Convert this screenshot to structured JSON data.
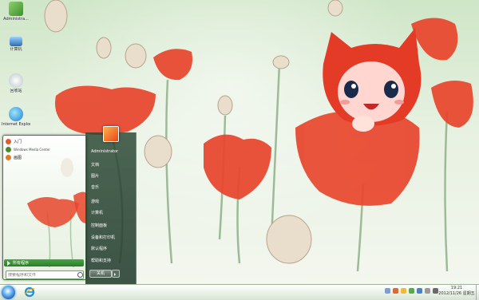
{
  "desktop": {
    "icons": [
      {
        "label": "Administra...",
        "icon": "user-folder-icon"
      },
      {
        "label": "计算机",
        "icon": "computer-icon"
      },
      {
        "label": "回收站",
        "icon": "recycle-bin-icon"
      },
      {
        "label": "Internet Explorer",
        "icon": "internet-explorer-icon"
      }
    ]
  },
  "start_menu": {
    "pinned": [
      {
        "label": "入门",
        "sub": "",
        "color": "#e55a2b"
      },
      {
        "label": "Windows Media Center",
        "sub": "",
        "color": "#4a8a2a"
      },
      {
        "label": "画图",
        "sub": "",
        "color": "#e07a2a"
      }
    ],
    "all_programs": "所有程序",
    "search_placeholder": "搜索程序和文件",
    "user_name": "Administrator",
    "right_items": [
      "文档",
      "图片",
      "音乐",
      "游戏",
      "计算机",
      "控制面板",
      "设备和打印机",
      "默认程序",
      "帮助和支持"
    ],
    "shutdown": "关机"
  },
  "taskbar": {
    "start_icon": "windows-start-orb-icon",
    "pinned_icon": "internet-explorer-icon",
    "clock_time": "19:21",
    "clock_date": "2012/11/26 星期五"
  },
  "colors": {
    "accent_green": "#2c7d2a",
    "poppy_red": "#e8452c",
    "taskbar_bg": "#e9f1e6"
  }
}
